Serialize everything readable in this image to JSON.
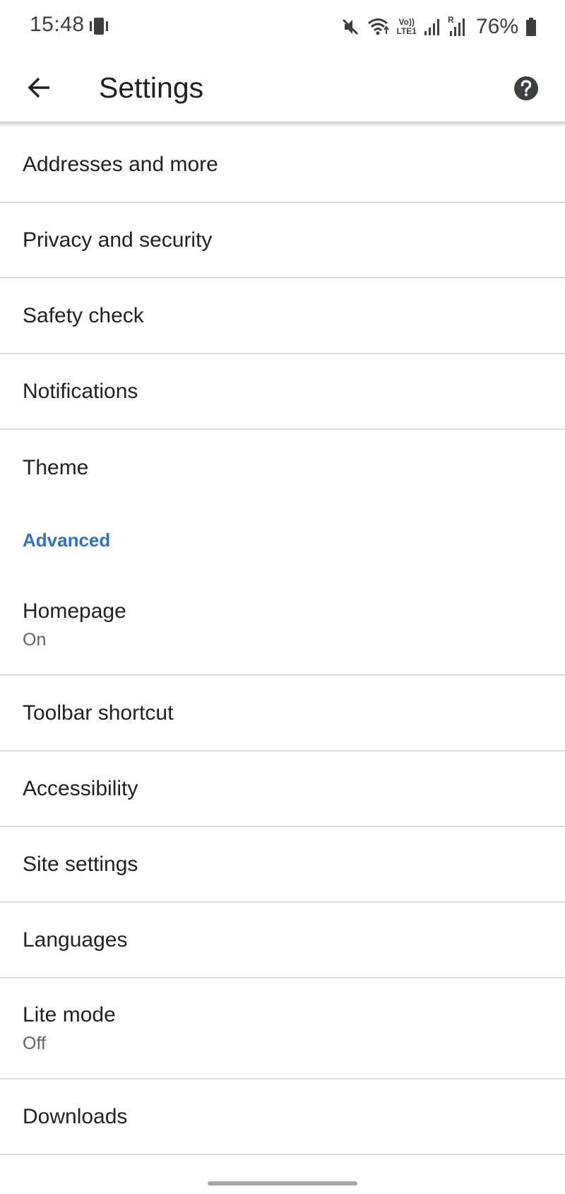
{
  "status_bar": {
    "time": "15:48",
    "battery_percent": "76%",
    "network_label_top": "Vo))",
    "network_label_bottom": "LTE1",
    "roaming_label": "R",
    "icons": [
      "phone-vibrate-icon",
      "mute-icon",
      "wifi-icon",
      "volte-icon",
      "signal-icon",
      "signal-roaming-icon",
      "battery-icon"
    ]
  },
  "app_bar": {
    "title": "Settings",
    "back_icon": "arrow-back-icon",
    "help_icon": "help-circle-icon"
  },
  "colors": {
    "accent": "#2f74c0",
    "text_primary": "#202124",
    "text_secondary": "#5f6368",
    "divider": "#dadce0"
  },
  "list": {
    "items_basic": [
      {
        "title": "Addresses and more"
      },
      {
        "title": "Privacy and security"
      },
      {
        "title": "Safety check"
      },
      {
        "title": "Notifications"
      },
      {
        "title": "Theme"
      }
    ],
    "advanced_header": "Advanced",
    "items_advanced": [
      {
        "title": "Homepage",
        "subtitle": "On"
      },
      {
        "title": "Toolbar shortcut"
      },
      {
        "title": "Accessibility"
      },
      {
        "title": "Site settings"
      },
      {
        "title": "Languages"
      },
      {
        "title": "Lite mode",
        "subtitle": "Off"
      },
      {
        "title": "Downloads"
      }
    ]
  }
}
